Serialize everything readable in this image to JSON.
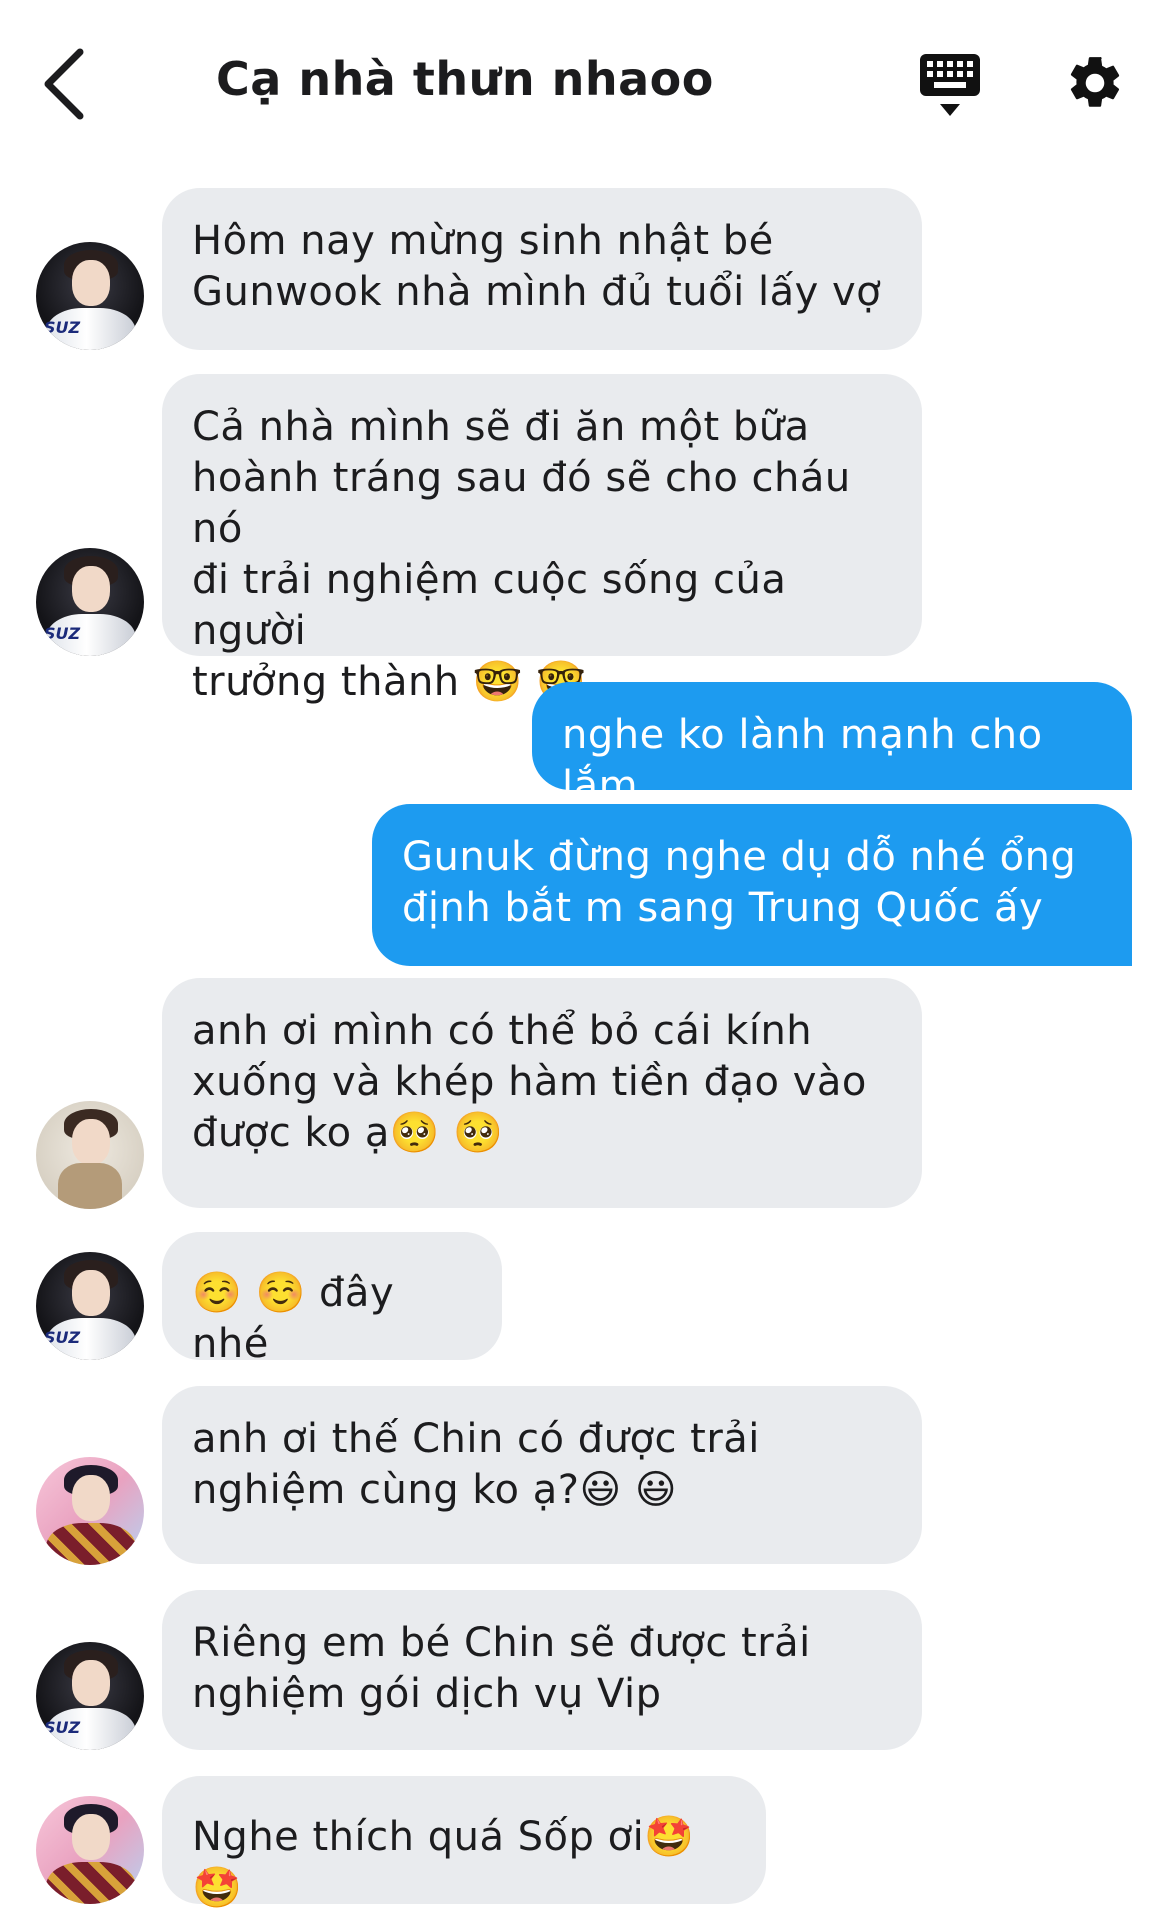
{
  "header": {
    "title": "Cạ nhà thưn nhaoo",
    "back_icon": "chevron-left-icon",
    "keyboard_icon": "keyboard-icon",
    "settings_icon": "gear-icon"
  },
  "colors": {
    "incoming_bubble": "#e9ebee",
    "outgoing_bubble": "#1d9bf0",
    "text": "#1c1c1e"
  },
  "messages": [
    {
      "direction": "incoming",
      "text": "Hôm nay mừng sinh nhật bé\nGunwook nhà mình đủ tuổi lấy vợ",
      "avatar": "avatar-a"
    },
    {
      "direction": "incoming",
      "text": "Cả nhà mình sẽ đi ăn một bữa\nhoành tráng sau đó sẽ cho cháu nó\nđi trải nghiệm cuộc sống của người\ntrưởng thành 🤓 🤓",
      "avatar": "avatar-a"
    },
    {
      "direction": "outgoing",
      "text": "nghe ko lành mạnh cho lắm"
    },
    {
      "direction": "outgoing",
      "text": "Gunuk đừng nghe dụ dỗ nhé ổng\nđịnh bắt m sang Trung Quốc ấy"
    },
    {
      "direction": "incoming",
      "text": "anh ơi mình có thể bỏ cái kính\nxuống và khép hàm tiền đạo vào\nđược ko ạ🥺 🥺",
      "avatar": "avatar-b"
    },
    {
      "direction": "incoming",
      "text": "☺️ ☺️  đây nhé",
      "avatar": "avatar-a"
    },
    {
      "direction": "incoming",
      "text": "anh ơi thế Chin có được trải\nnghiệm cùng ko ạ?😃 😃",
      "avatar": "avatar-c"
    },
    {
      "direction": "incoming",
      "text": "Riêng em bé Chin sẽ được trải\nnghiệm gói dịch vụ Vip",
      "avatar": "avatar-a"
    },
    {
      "direction": "incoming",
      "text": "Nghe thích quá Sốp ơi🤩 🤩",
      "avatar": "avatar-c"
    }
  ],
  "avatar_text": "SUZ"
}
